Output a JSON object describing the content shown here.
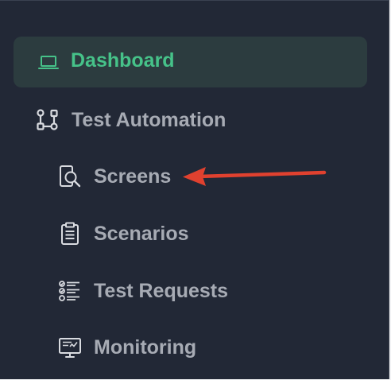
{
  "colors": {
    "background": "#222836",
    "active_bg": "#2c3c3f",
    "active_text": "#46c289",
    "text": "#a7abb4",
    "annotation_arrow": "#e0412f"
  },
  "nav": {
    "dashboard": {
      "label": "Dashboard",
      "icon": "laptop-icon",
      "active": true
    },
    "test_automation": {
      "label": "Test Automation",
      "icon": "workflow-icon",
      "children": [
        {
          "label": "Screens",
          "icon": "screen-search-icon"
        },
        {
          "label": "Scenarios",
          "icon": "clipboard-icon"
        },
        {
          "label": "Test Requests",
          "icon": "checklist-icon"
        },
        {
          "label": "Monitoring",
          "icon": "monitor-icon"
        }
      ]
    }
  },
  "annotation": {
    "type": "arrow",
    "points_to": "Screens"
  }
}
